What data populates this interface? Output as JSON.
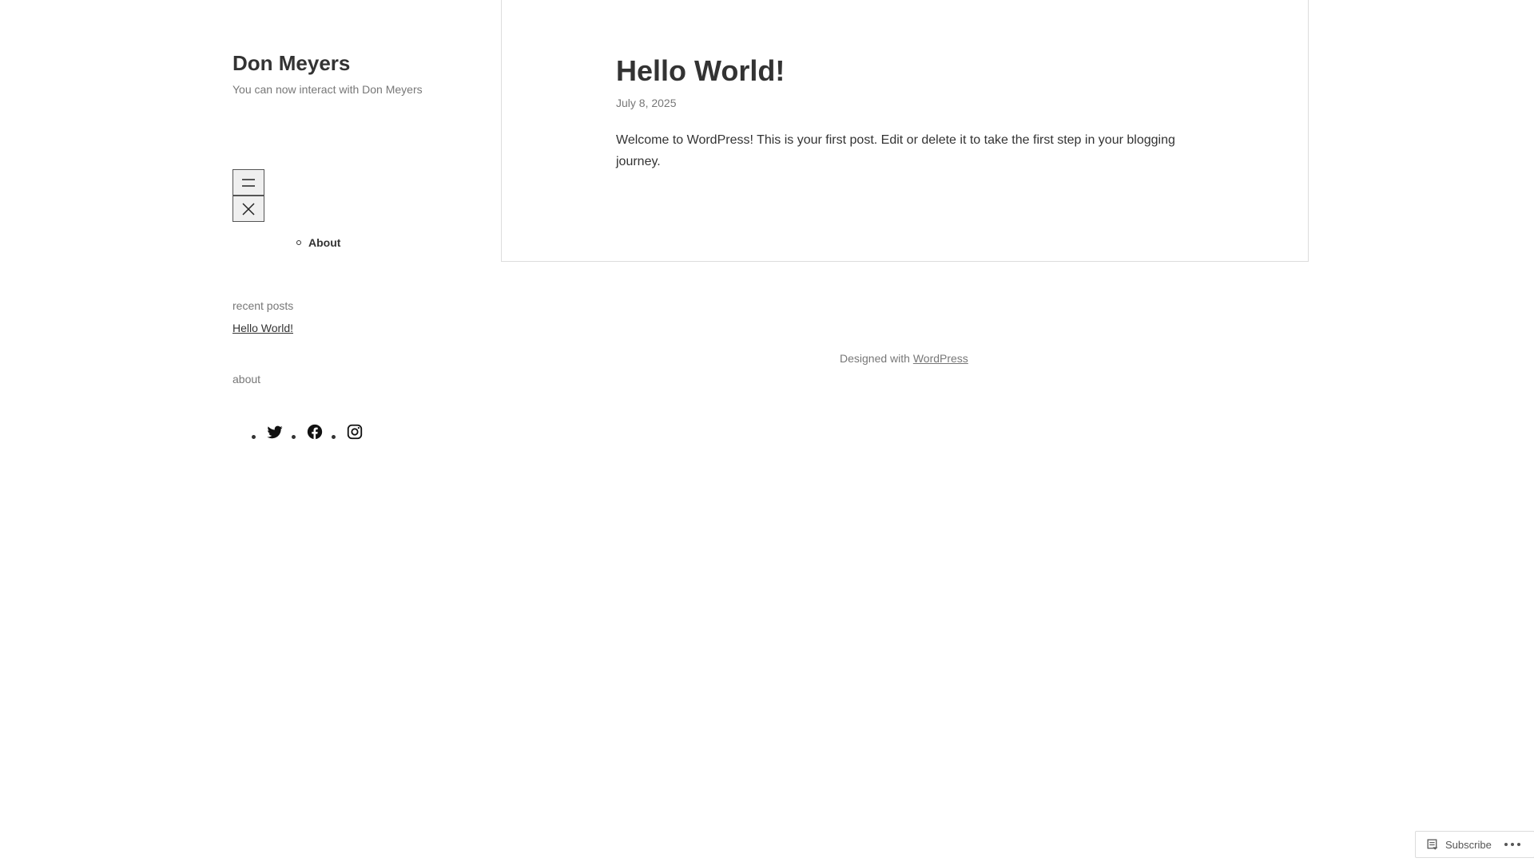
{
  "site": {
    "title": "Don Meyers",
    "tagline": "You can now interact with Don Meyers"
  },
  "nav": {
    "open_icon": "menu-icon",
    "close_icon": "close-icon",
    "items": [
      {
        "label": "About"
      }
    ]
  },
  "widgets": {
    "recent_posts": {
      "title": "recent posts",
      "items": [
        {
          "label": "Hello World!"
        }
      ]
    },
    "about": {
      "title": "about",
      "social_icons": [
        "twitter-icon",
        "facebook-icon",
        "instagram-icon"
      ]
    }
  },
  "post": {
    "title": "Hello World!",
    "date": "July 8, 2025",
    "content": "Welcome to WordPress! This is your first post. Edit or delete it to take the first step in your blogging journey."
  },
  "footer": {
    "prefix": "Designed with ",
    "link_label": "WordPress"
  },
  "subscribe": {
    "label": "Subscribe",
    "more_icon": "ellipsis-icon"
  },
  "colors": {
    "text": "#333333",
    "muted": "#777777",
    "border": "#dddddd",
    "background": "#ffffff"
  }
}
